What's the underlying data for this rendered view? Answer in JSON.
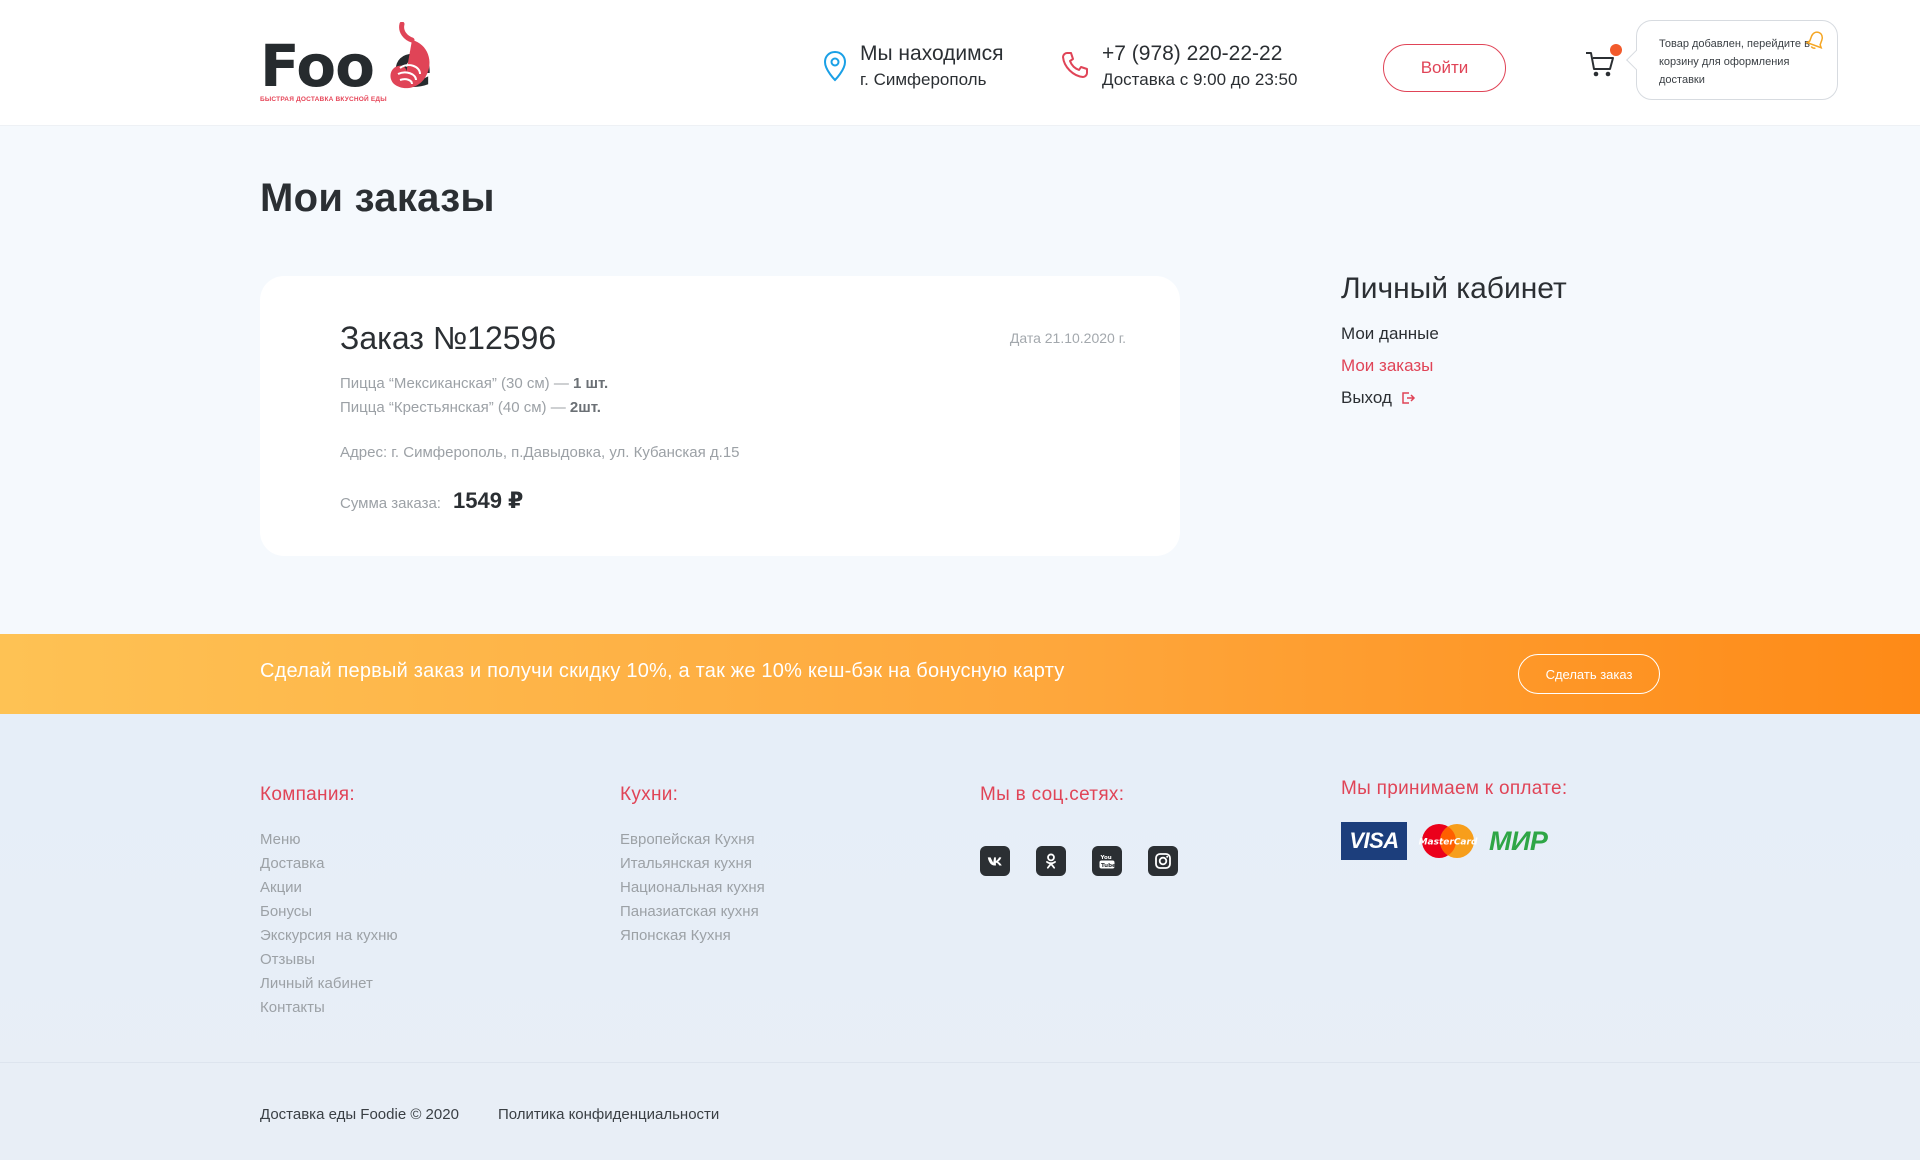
{
  "header": {
    "logo_text": "Foo e",
    "logo_tagline": "БЫСТРАЯ ДОСТАВКА ВКУСНОЙ ЕДЫ",
    "location_title": "Мы находимся",
    "location_city": "г. Симферополь",
    "phone": "+7 (978) 220-22-22",
    "hours": "Доставка с 9:00 до 23:50",
    "login_label": "Войти",
    "toast": "Товар добавлен, перейдите в корзину для оформления доставки"
  },
  "page": {
    "title": "Мои заказы"
  },
  "order": {
    "title": "Заказ №12596",
    "date": "Дата 21.10.2020 г.",
    "items": [
      {
        "name": "Пицца “Мексиканская” (30 см) —",
        "qty": "1 шт."
      },
      {
        "name": "Пицца “Крестьянская” (40 см) —",
        "qty": "2шт."
      }
    ],
    "address": "Адрес: г. Симферополь, п.Давыдовка, ул. Кубанская д.15",
    "sum_label": "Сумма заказа:",
    "sum_value": "1549 ₽"
  },
  "sidebar": {
    "title": "Личный кабинет",
    "links": [
      "Мои данные",
      "Мои заказы",
      "Выход"
    ]
  },
  "promo": {
    "text": "Сделай первый заказ и получи скидку 10%, а так же 10% кеш-бэк на бонусную карту",
    "button": "Сделать заказ"
  },
  "footer": {
    "company_title": "Компания:",
    "company_links": [
      "Меню",
      "Доставка",
      "Акции",
      "Бонусы",
      "Экскурсия на кухню",
      "Отзывы",
      "Личный кабинет",
      "Контакты"
    ],
    "kitchens_title": "Кухни:",
    "kitchens_links": [
      "Европейская Кухня",
      "Итальянская кухня",
      "Национальная кухня",
      "Паназиатская кухня",
      "Японская Кухня"
    ],
    "social_title": "Мы в соц.сетях:",
    "social_icons": [
      "vk-icon",
      "odnoklassniki-icon",
      "youtube-icon",
      "instagram-icon"
    ],
    "payment_title": "Мы принимаем к оплате:",
    "payment_visa": "VISA",
    "payment_mc": "MasterCard",
    "payment_mir": "МИР",
    "copyright": "Доставка еды Foodie © 2020",
    "privacy": "Политика конфиденциальности"
  },
  "colors": {
    "accent": "#e04457",
    "promo_start": "#fec254",
    "promo_end": "#fe8a17",
    "cart_dot": "#f25a2b"
  }
}
